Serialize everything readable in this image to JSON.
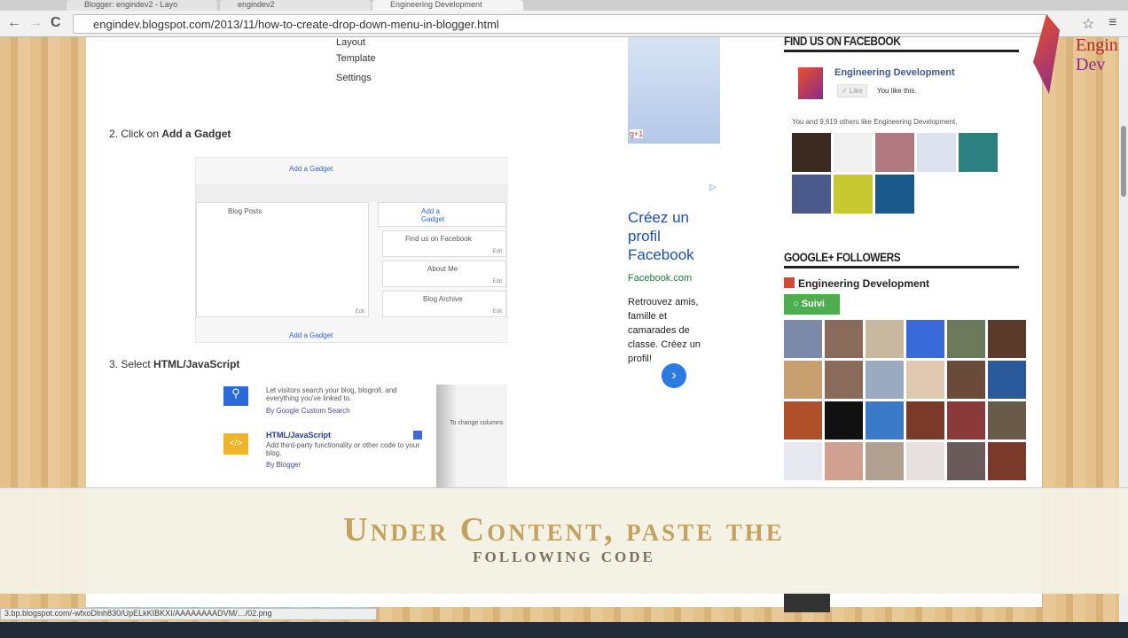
{
  "browser": {
    "tabs": [
      "Blogger: engindev2 - Layo",
      "engindev2",
      "Engineering Development"
    ],
    "url": "engindev.blogspot.com/2013/11/how-to-create-drop-down-menu-in-blogger.html",
    "status_url": "3.bp.blogspot.com/-wfxoDlnh830/UpELkKIBKXI/AAAAAAAADVM/…/02.png"
  },
  "logo": {
    "text1": "Engin",
    "text2": "Dev"
  },
  "article": {
    "menu_items": [
      "Layout",
      "Template",
      "Settings"
    ],
    "step2_prefix": "2.  Click on ",
    "step2_bold": "Add a Gadget",
    "layout_shot": {
      "add_gadget": "Add a Gadget",
      "blog_posts": "Blog Posts",
      "widgets": [
        "Find us on Facebook",
        "About Me",
        "Blog Archive"
      ],
      "edit": "Edit"
    },
    "step3_prefix": "3.  Select ",
    "step3_bold": "HTML/JavaScript",
    "gadget_shot": {
      "search_desc": "Let visitors search your blog, blogroll, and everything you've linked to.",
      "search_by": "By Google Custom Search",
      "html_title": "HTML/JavaScript",
      "html_desc": "Add third-party functionality or other code to your blog.",
      "html_by": "By Blogger",
      "side_note": "To change columns"
    }
  },
  "ad": {
    "gplus": "g+1",
    "title": "Créez un profil Facebook",
    "domain": "Facebook.com",
    "body": "Retrouvez amis, famille et camarades de classe. Créez un profil!"
  },
  "sidebar": {
    "fb_heading": "FIND US ON FACEBOOK",
    "fb_page": "Engineering Development",
    "like": "✓ Like",
    "you_like": "You like this.",
    "fb_count": "You and 9,619 others like Engineering Development.",
    "gplus_heading": "GOOGLE+ FOLLOWERS",
    "gplus_page": "Engineering Development",
    "follow": "Suivi"
  },
  "caption": {
    "line1": "Under Content, paste the",
    "line2": "following code"
  },
  "colors": {
    "caption_gold": "#c3a25f",
    "fb_blue": "#3b5998",
    "follow_green": "#4cae4c"
  }
}
